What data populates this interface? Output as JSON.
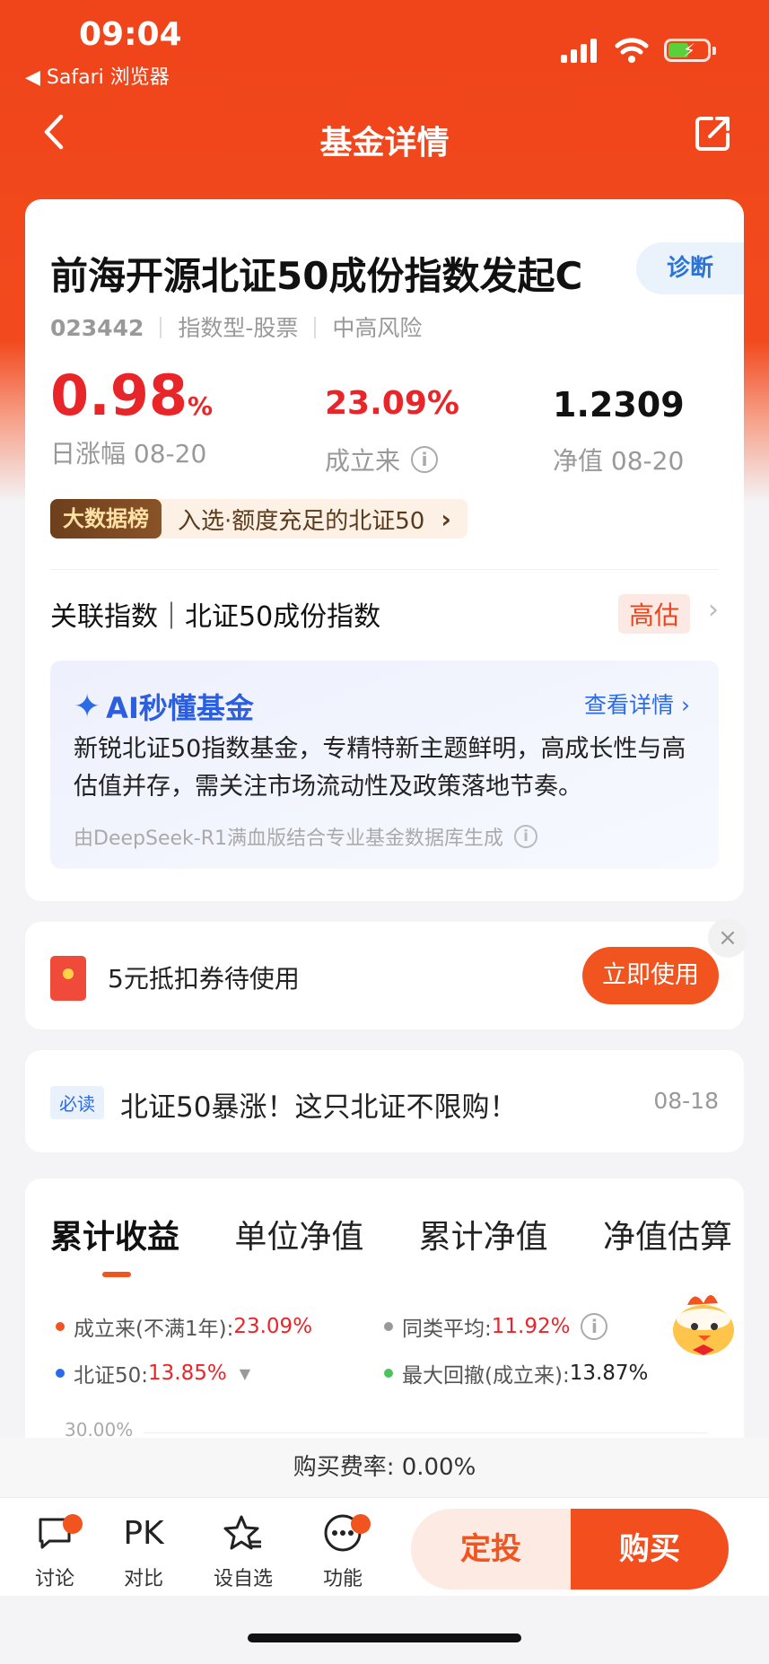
{
  "status_bar": {
    "time": "09:04",
    "back_app": "◀ Safari 浏览器"
  },
  "header": {
    "title": "基金详情"
  },
  "fund": {
    "name": "前海开源北证50成份指数发起C",
    "diagnose_label": "诊断",
    "code": "023442",
    "type": "指数型-股票",
    "risk": "中高风险",
    "daily_change": "0.98",
    "daily_change_unit": "%",
    "daily_change_label": "日涨幅 08-20",
    "since_inception": "23.09%",
    "since_inception_label": "成立来",
    "nav": "1.2309",
    "nav_label": "净值 08-20"
  },
  "big_data": {
    "tag": "大数据榜",
    "text": "入选·额度充足的北证50",
    "chevron": "›"
  },
  "related_index": {
    "text": "关联指数｜北证50成份指数",
    "valuation": "高估"
  },
  "ai": {
    "title": "AI秒懂基金",
    "more": "查看详情 ›",
    "summary": "新锐北证50指数基金，专精特新主题鲜明，高成长性与高估值并存，需关注市场流动性及政策落地节奏。",
    "footnote": "由DeepSeek-R1满血版结合专业基金数据库生成"
  },
  "coupon": {
    "text": "5元抵扣券待使用",
    "button": "立即使用",
    "close": "×"
  },
  "news": {
    "tag": "必读",
    "title": "北证50暴涨！这只北证不限购！",
    "date": "08-18"
  },
  "chart_tabs": [
    "累计收益",
    "单位净值",
    "累计净值",
    "净值估算"
  ],
  "legend": {
    "fund_label": "成立来(不满1年):",
    "fund_value": "23.09%",
    "peer_label": "同类平均:",
    "peer_value": "11.92%",
    "index_label": "北证50:",
    "index_value": "13.85%",
    "drawdown_label": "最大回撤(成立来):",
    "drawdown_value": "13.87%"
  },
  "chart_data": {
    "type": "line",
    "y_tick_top": "30.00%"
  },
  "fee": {
    "text": "购买费率: 0.00%"
  },
  "bottom_bar": {
    "discuss": "讨论",
    "compare_icon": "PK",
    "compare": "对比",
    "watchlist": "设自选",
    "functions": "功能",
    "auto_invest": "定投",
    "buy": "购买"
  },
  "colors": {
    "brand": "#f24e1e",
    "up": "#e8262a",
    "fund_dot": "#f2541f",
    "peer_dot": "#999999",
    "index_dot": "#2b6be8",
    "drawdown_dot": "#4cc35a"
  }
}
